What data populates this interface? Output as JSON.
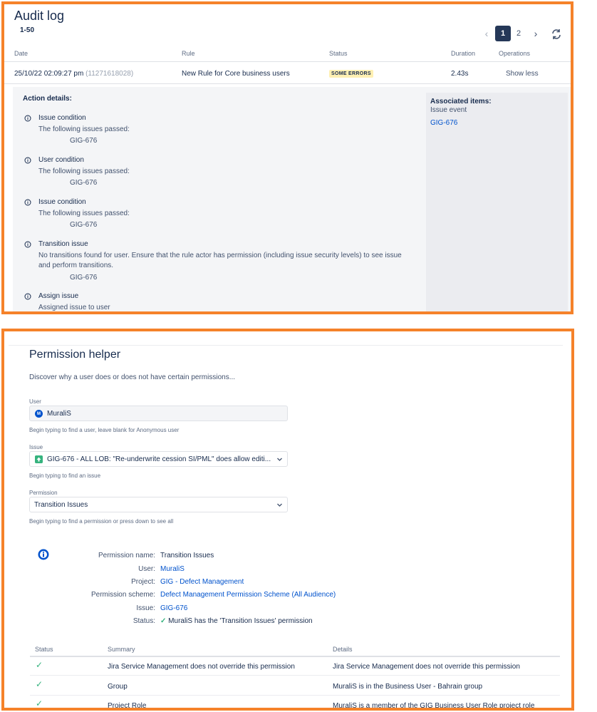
{
  "audit": {
    "title": "Audit log",
    "range": "1-50",
    "pagination": {
      "prev": "‹",
      "pages": [
        "1",
        "2"
      ],
      "current": "1",
      "next": "›"
    },
    "columns": [
      "Date",
      "Rule",
      "Status",
      "Duration",
      "Operations"
    ],
    "row": {
      "date": "25/10/22 02:09:27 pm",
      "id": "(11271618028)",
      "rule": "New Rule for Core business users",
      "status": "SOME ERRORS",
      "duration": "2.43s",
      "operation": "Show less"
    },
    "details": {
      "title": "Action details:",
      "actions": [
        {
          "title": "Issue condition",
          "desc": "The following issues passed:",
          "key": "GIG-676"
        },
        {
          "title": "User condition",
          "desc": "The following issues passed:",
          "key": "GIG-676"
        },
        {
          "title": "Issue condition",
          "desc": "The following issues passed:",
          "key": "GIG-676"
        },
        {
          "title": "Transition issue",
          "desc1": "No transitions found for user. Ensure that the rule actor has permission (including issue security levels) to see issue",
          "desc2": "and perform transitions.",
          "key": "GIG-676"
        },
        {
          "title": "Assign issue",
          "desc": "Assigned issue to user"
        }
      ],
      "associated": {
        "title": "Associated items:",
        "sub": "Issue event",
        "link": "GIG-676"
      }
    }
  },
  "permission": {
    "title": "Permission helper",
    "desc": "Discover why a user does or does not have certain permissions...",
    "user": {
      "label": "User",
      "value": "MuraliS",
      "avatar": "M",
      "help": "Begin typing to find a user, leave blank for Anonymous user"
    },
    "issue": {
      "label": "Issue",
      "value": "GIG-676 - ALL LOB: \"Re-underwrite cession SI/PML\" does allow editi...",
      "help": "Begin typing to find an issue"
    },
    "permission": {
      "label": "Permission",
      "value": "Transition Issues",
      "help": "Begin typing to find a permission or press down to see all"
    },
    "result": {
      "permission_name_label": "Permission name:",
      "permission_name": "Transition Issues",
      "user_label": "User:",
      "user": "MuraliS",
      "project_label": "Project:",
      "project": "GIG - Defect Management",
      "scheme_label": "Permission scheme:",
      "scheme": "Defect Management Permission Scheme (All Audience)",
      "issue_label": "Issue:",
      "issue": "GIG-676",
      "status_label": "Status:",
      "status": "MuraliS has the 'Transition Issues' permission"
    },
    "table": {
      "columns": [
        "Status",
        "Summary",
        "Details"
      ],
      "rows": [
        {
          "summary": "Jira Service Management does not override this permission",
          "details": "Jira Service Management does not override this permission"
        },
        {
          "summary": "Group",
          "details": "MuraliS is in the Business User - Bahrain group"
        },
        {
          "summary": "Project Role",
          "details": "MuraliS is a member of the GIG Business User Role project role"
        }
      ]
    }
  },
  "colors": {
    "accent_border": "#f5822a",
    "link": "#0052cc",
    "success": "#36b37e",
    "badge_bg": "#fff0b3"
  }
}
